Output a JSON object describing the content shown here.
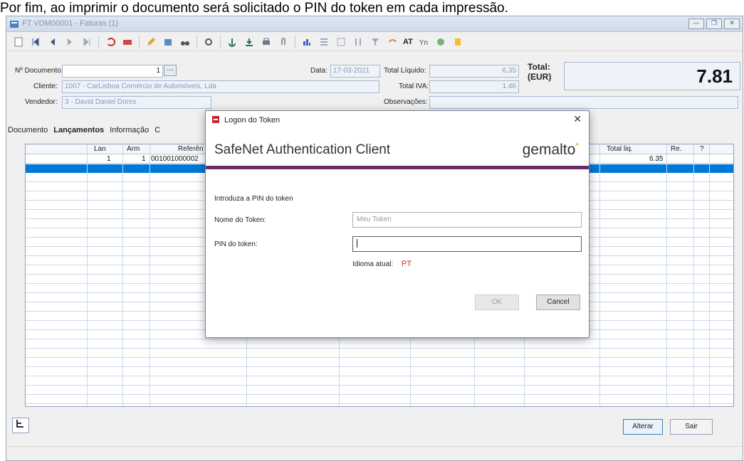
{
  "caption": "Por fim, ao imprimir o documento será solicitado o PIN do token em cada impressão.",
  "window": {
    "title": "FT VDM00001 - Faturas (1)",
    "buttons": [
      "—",
      "❐",
      "✕"
    ]
  },
  "toolbar": {
    "at_label": "AT"
  },
  "form": {
    "doc_number_label": "Nº Documento:",
    "doc_number_value": "1",
    "date_label": "Data:",
    "date_value": "17-03-2021",
    "client_label": "Cliente:",
    "client_value": "1007 - CarLisboa Comércio de Automóveis, Lda",
    "seller_label": "Vendedor:",
    "seller_value": "3 - David Daniel Dores",
    "total_liquid_label": "Total Líquido:",
    "total_liquid_value": "6.35",
    "total_iva_label": "Total IVA:",
    "total_iva_value": "1.46",
    "notes_label": "Observações:",
    "total_label": "Total:",
    "total_currency": "(EUR)",
    "total_value": "7.81"
  },
  "tabs": [
    {
      "label": "Documento",
      "active": false
    },
    {
      "label": "Lançamentos",
      "active": true
    },
    {
      "label": "Informação",
      "active": false
    },
    {
      "label": "C",
      "active": false
    }
  ],
  "grid": {
    "columns": {
      "lan": "Lan",
      "arm": "Arm",
      "ref": "Referên",
      "total_liq": "Total liq.",
      "re": "Re.",
      "q": "?"
    },
    "rows": [
      {
        "lan": "1",
        "arm": "1",
        "ref": "001001000002",
        "total_liq": "6.35"
      }
    ]
  },
  "buttons": {
    "alterar": "Alterar",
    "sair": "Sair"
  },
  "dialog": {
    "title": "Logon do Token",
    "header": "SafeNet Authentication Client",
    "brand": "gemalto",
    "brand_mark": "*",
    "intro": "Introduza a PIN do token",
    "token_name_label": "Nome do Token:",
    "token_name_value": "Meu Token",
    "pin_label": "PIN do token:",
    "lang_label": "Idioma atual:",
    "lang_value": "PT",
    "ok_label": "OK",
    "cancel_label": "Cancel"
  },
  "colors": {
    "selection": "#0078d7",
    "dialog_accent": "#6b2c6b",
    "brand_accent": "#e8a20a"
  }
}
